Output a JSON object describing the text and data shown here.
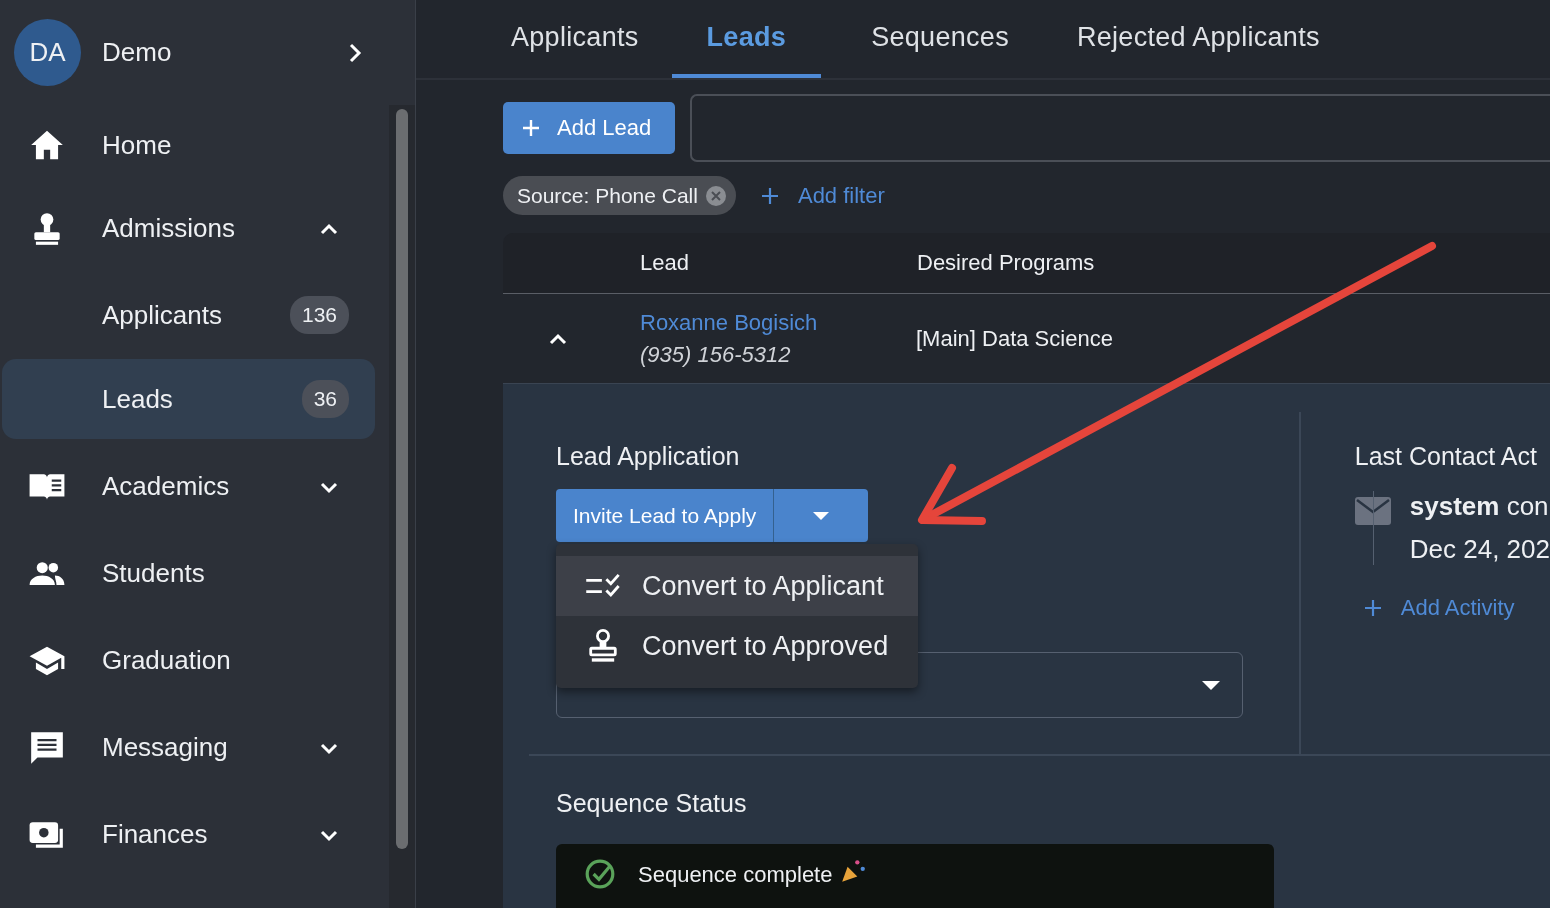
{
  "sidebar": {
    "user": {
      "initials": "DA",
      "name": "Demo"
    },
    "items": [
      {
        "label": "Home"
      },
      {
        "label": "Admissions",
        "expanded": true,
        "children": [
          {
            "label": "Applicants",
            "count": "136",
            "selected": false
          },
          {
            "label": "Leads",
            "count": "36",
            "selected": true
          }
        ]
      },
      {
        "label": "Academics",
        "expanded": false
      },
      {
        "label": "Students"
      },
      {
        "label": "Graduation"
      },
      {
        "label": "Messaging",
        "expanded": false
      },
      {
        "label": "Finances",
        "expanded": false
      }
    ]
  },
  "tabs": [
    {
      "label": "Applicants",
      "selected": false
    },
    {
      "label": "Leads",
      "selected": true
    },
    {
      "label": "Sequences",
      "selected": false
    },
    {
      "label": "Rejected Applicants",
      "selected": false
    }
  ],
  "toolbar": {
    "add_button": "Add Lead",
    "filter_chip": "Source: Phone Call",
    "add_filter": "Add filter"
  },
  "table": {
    "columns": [
      "Lead",
      "Desired Programs"
    ],
    "rows": [
      {
        "name": "Roxanne Bogisich",
        "phone": "(935) 156-5312",
        "program": "[Main] Data Science",
        "expanded": true
      }
    ]
  },
  "detail": {
    "application_title": "Lead Application",
    "split_button": "Invite Lead to Apply",
    "menu": [
      {
        "label": "Convert to Applicant",
        "selected": true
      },
      {
        "label": "Convert to Approved",
        "selected": false
      }
    ],
    "activity_title": "Last Contact Act",
    "activity": {
      "actor": "system",
      "action": "con",
      "date": "Dec 24, 202"
    },
    "add_activity": "Add Activity",
    "sequence_title": "Sequence Status",
    "sequence_text": "Sequence complete"
  }
}
